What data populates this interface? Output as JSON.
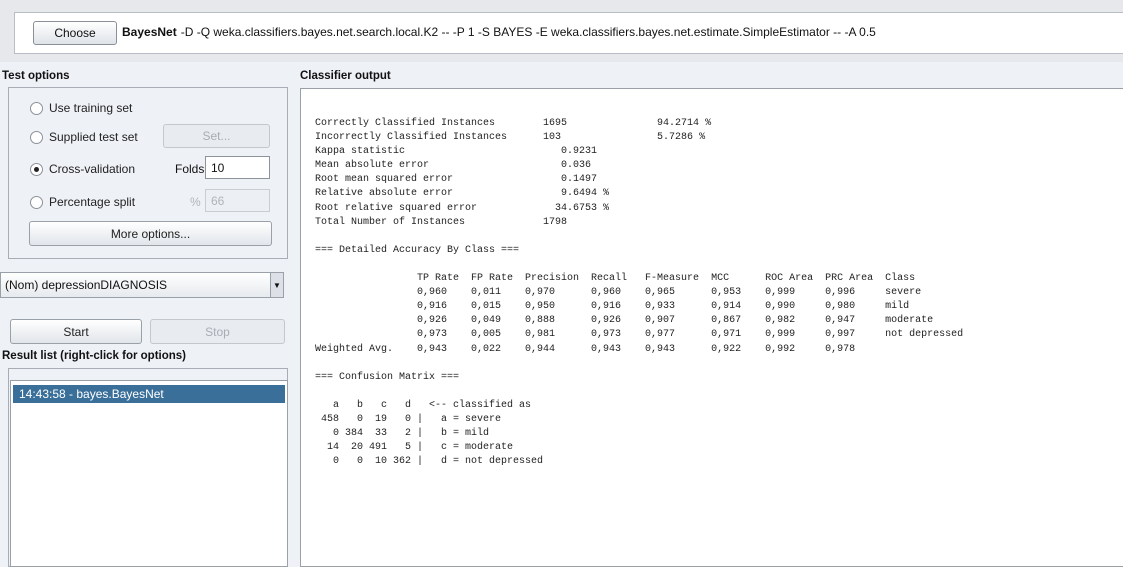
{
  "classifier": {
    "choose_label": "Choose",
    "name": "BayesNet",
    "options": "-D -Q weka.classifiers.bayes.net.search.local.K2 -- -P 1 -S BAYES -E weka.classifiers.bayes.net.estimate.SimpleEstimator -- -A 0.5"
  },
  "test_options": {
    "title": "Test options",
    "use_training_set": "Use training set",
    "supplied_test_set": "Supplied test set",
    "set_label": "Set...",
    "cross_validation": "Cross-validation",
    "folds_label": "Folds",
    "folds_value": "10",
    "percentage_split": "Percentage split",
    "percent_sign": "%",
    "percent_value": "66",
    "selected": "cross_validation",
    "more_options": "More options..."
  },
  "class_attribute": "(Nom) depressionDIAGNOSIS",
  "controls": {
    "start": "Start",
    "stop": "Stop"
  },
  "result_list": {
    "title": "Result list (right-click for options)",
    "items": [
      "14:43:58 - bayes.BayesNet"
    ]
  },
  "output": {
    "title": "Classifier output",
    "lines": [
      "Correctly Classified Instances        1695               94.2714 %",
      "Incorrectly Classified Instances      103                5.7286 %",
      "Kappa statistic                          0.9231",
      "Mean absolute error                      0.036",
      "Root mean squared error                  0.1497",
      "Relative absolute error                  9.6494 %",
      "Root relative squared error             34.6753 %",
      "Total Number of Instances             1798",
      "",
      "=== Detailed Accuracy By Class ===",
      "",
      "                 TP Rate  FP Rate  Precision  Recall   F-Measure  MCC      ROC Area  PRC Area  Class",
      "                 0,960    0,011    0,970      0,960    0,965      0,953    0,999     0,996     severe",
      "                 0,916    0,015    0,950      0,916    0,933      0,914    0,990     0,980     mild",
      "                 0,926    0,049    0,888      0,926    0,907      0,867    0,982     0,947     moderate",
      "                 0,973    0,005    0,981      0,973    0,977      0,971    0,999     0,997     not depressed",
      "Weighted Avg.    0,943    0,022    0,944      0,943    0,943      0,922    0,992     0,978",
      "",
      "=== Confusion Matrix ===",
      "",
      "   a   b   c   d   <-- classified as",
      " 458   0  19   0 |   a = severe",
      "   0 384  33   2 |   b = mild",
      "  14  20 491   5 |   c = moderate",
      "   0   0  10 362 |   d = not depressed"
    ]
  }
}
